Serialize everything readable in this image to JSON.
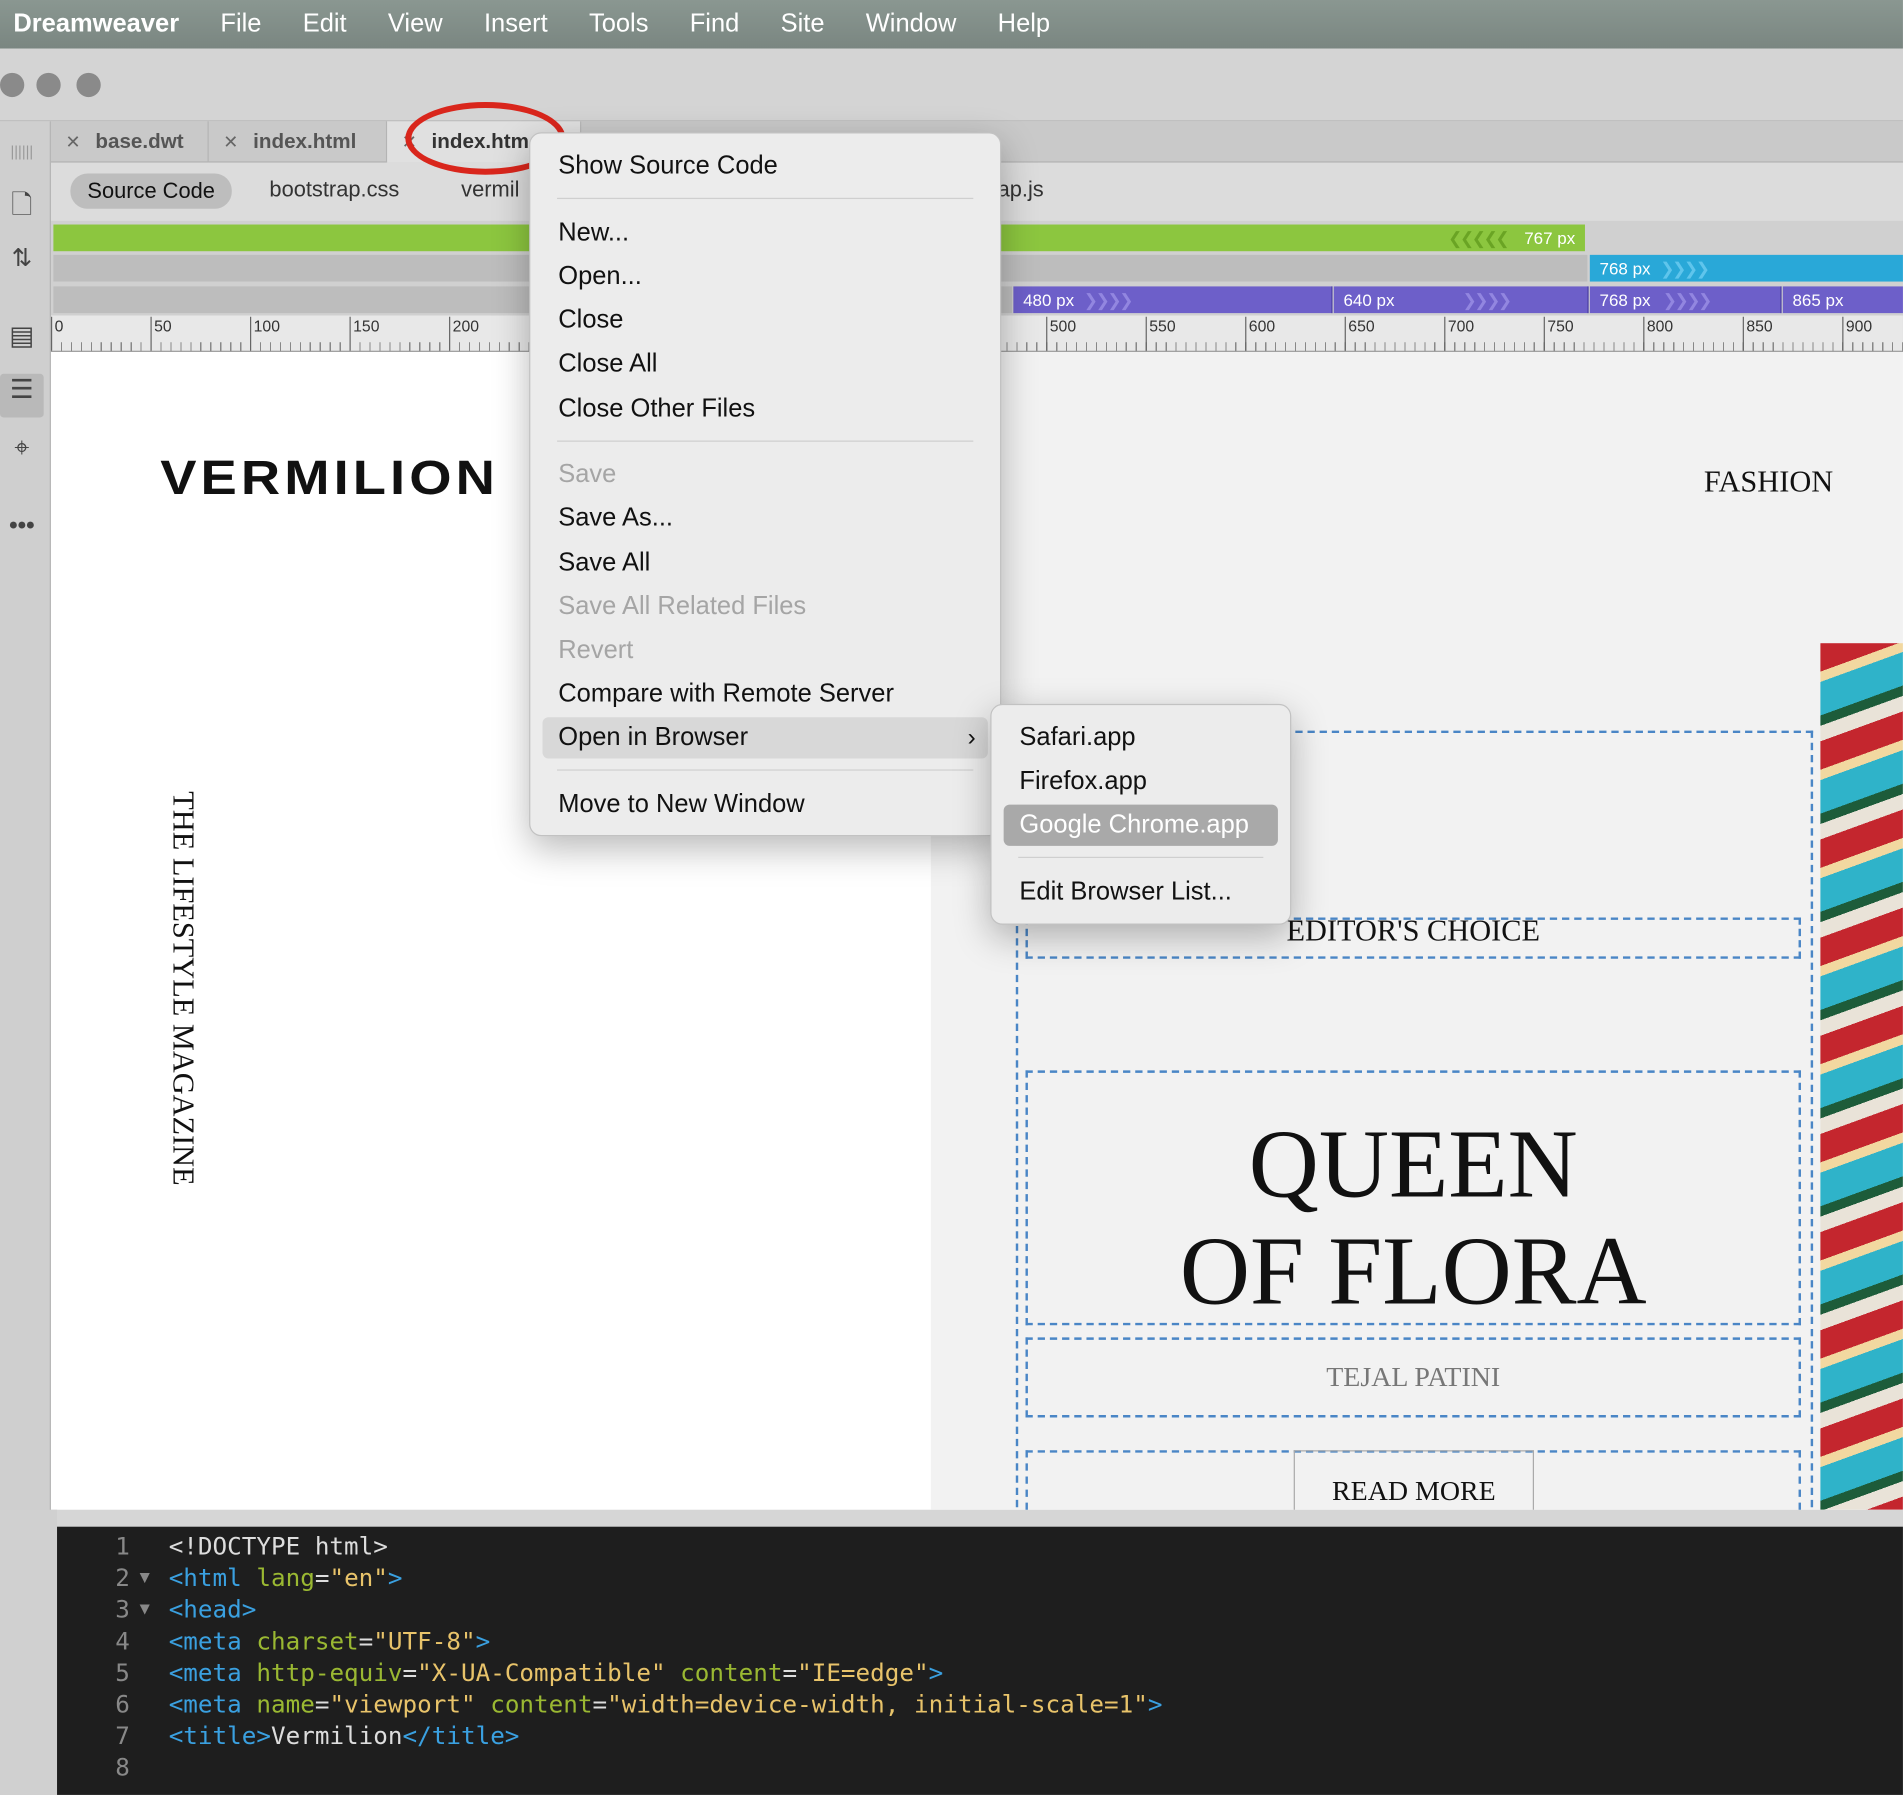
{
  "menubar": {
    "app": "Dreamweaver",
    "items": [
      "File",
      "Edit",
      "View",
      "Insert",
      "Tools",
      "Find",
      "Site",
      "Window",
      "Help"
    ]
  },
  "tabs": [
    "base.dwt",
    "index.html",
    "index.htm"
  ],
  "related_files": [
    "Source Code",
    "bootstrap.css",
    "vermil",
    "ap.js"
  ],
  "media_queries": {
    "green": "767  px",
    "blue": "768  px",
    "purple": [
      "480  px",
      "640  px",
      "768  px",
      "865  px"
    ]
  },
  "ruler": [
    "0",
    "50",
    "100",
    "150",
    "200",
    "500",
    "550",
    "600",
    "650",
    "700",
    "750",
    "800",
    "850",
    "900"
  ],
  "design": {
    "logo": "VERMILION",
    "nav_right": "FASHION",
    "vertical_text": "THE LIFESTYLE MAGAZINE",
    "editors_choice": "EDITOR'S CHOICE",
    "headline_1": "QUEEN",
    "headline_2": "OF FLORA",
    "author": "TEJAL PATINI",
    "read_more": "READ MORE"
  },
  "context_menu": {
    "show_source": "Show Source Code",
    "new": "New...",
    "open": "Open...",
    "close": "Close",
    "close_all": "Close All",
    "close_other": "Close Other Files",
    "save": "Save",
    "save_as": "Save As...",
    "save_all": "Save All",
    "save_all_related": "Save All Related Files",
    "revert": "Revert",
    "compare": "Compare with Remote Server",
    "open_in_browser": "Open in Browser",
    "move_window": "Move to New Window"
  },
  "submenu": {
    "safari": "Safari.app",
    "firefox": "Firefox.app",
    "chrome": "Google Chrome.app",
    "edit_list": "Edit Browser List..."
  },
  "code": {
    "line_numbers": [
      "1",
      "2",
      "3",
      "4",
      "5",
      "6",
      "7",
      "8"
    ],
    "l1": "<!DOCTYPE html>",
    "l2a": "<html ",
    "l2b": "lang",
    "l2c": "=",
    "l2d": "\"en\"",
    "l2e": ">",
    "l3": "<head>",
    "l4a": "<meta ",
    "l4b": "charset",
    "l4c": "=",
    "l4d": "\"UTF-8\"",
    "l4e": ">",
    "l5a": "<meta ",
    "l5b": "http-equiv",
    "l5c": "=",
    "l5d": "\"X-UA-Compatible\"",
    "l5e": " content",
    "l5f": "=",
    "l5g": "\"IE=edge\"",
    "l5h": ">",
    "l6a": "<meta ",
    "l6b": "name",
    "l6c": "=",
    "l6d": "\"viewport\"",
    "l6e": " content",
    "l6f": "=",
    "l6g": "\"width=device-width, initial-scale=1\"",
    "l6h": ">",
    "l7a": "<title>",
    "l7b": "Vermilion",
    "l7c": "</title>"
  },
  "colors": {
    "menubar": "#7f8c86",
    "green_bar": "#8cc63f",
    "blue_bar": "#29a8d8",
    "purple_bar": "#6d5fc9",
    "highlight": "#d9261c"
  }
}
